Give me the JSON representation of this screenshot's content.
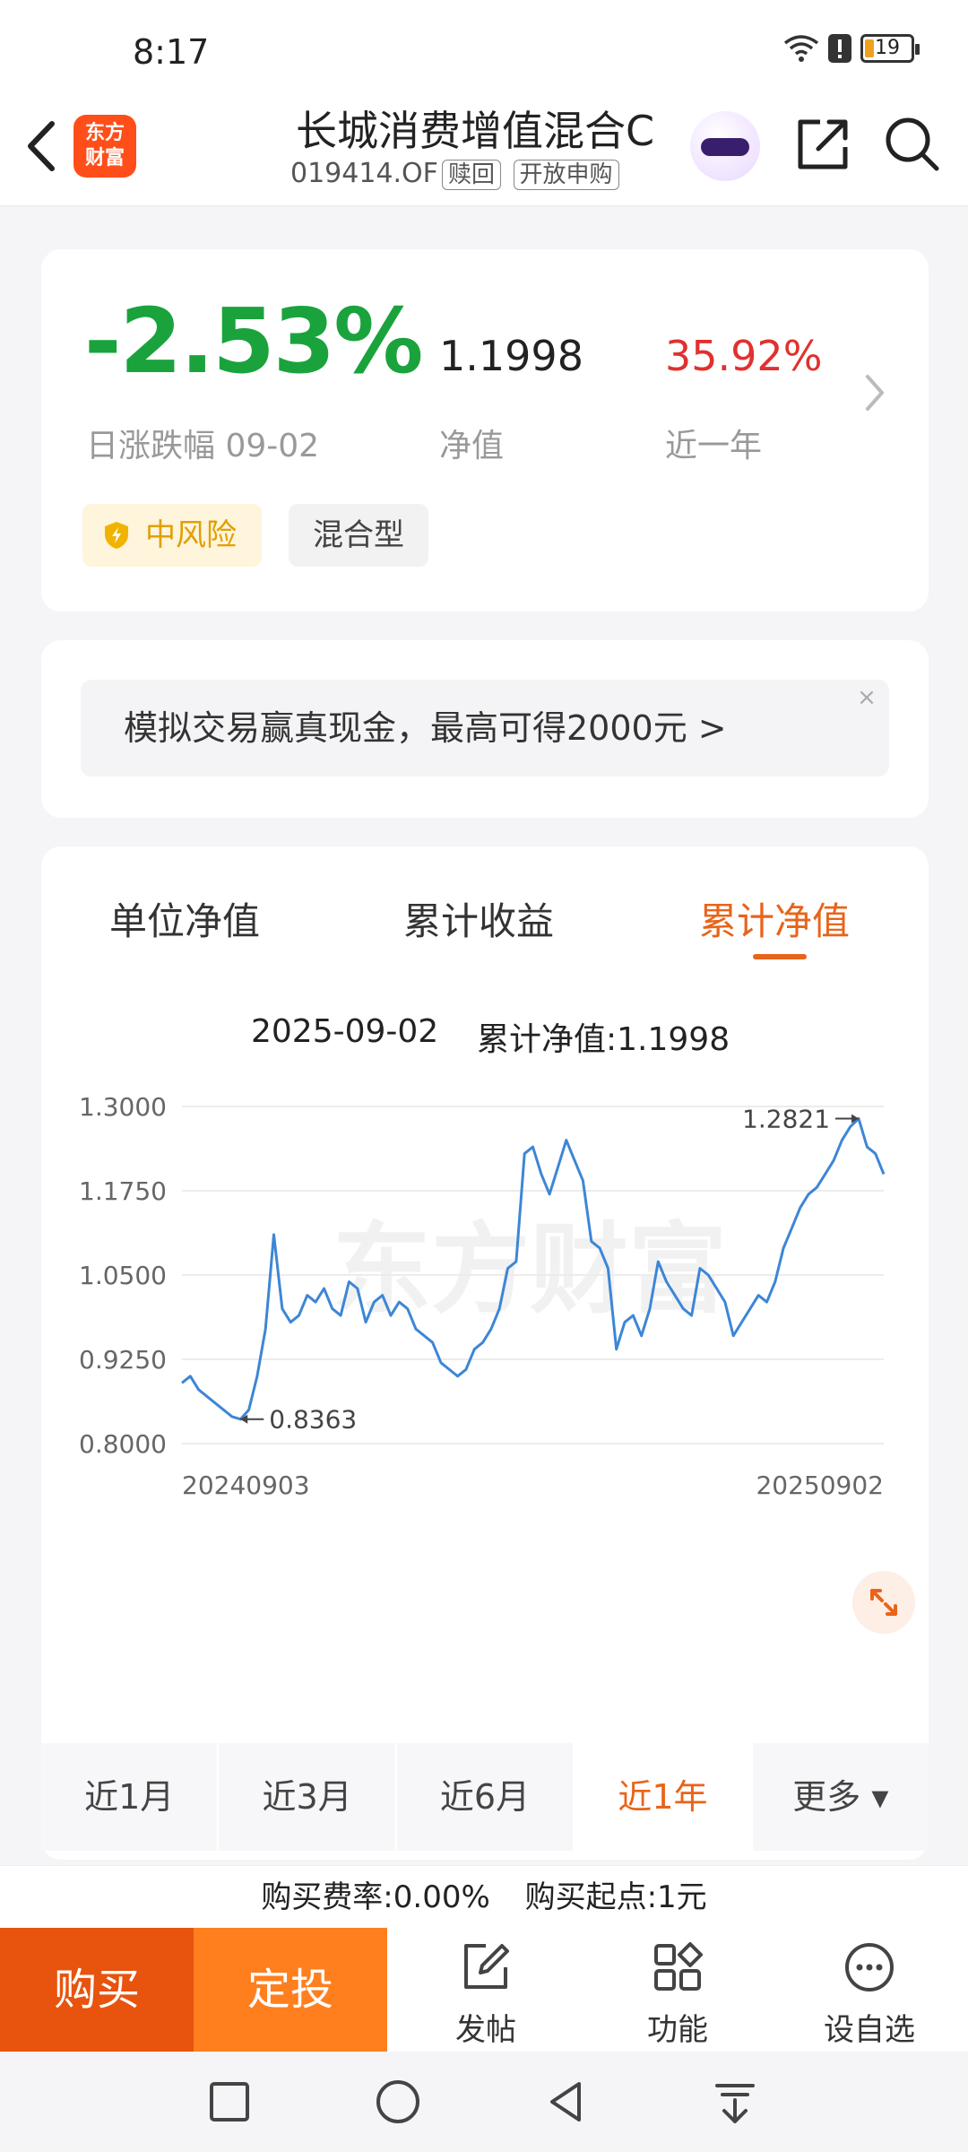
{
  "status": {
    "time": "8:17",
    "battery": "19"
  },
  "header": {
    "logo_line1": "东方",
    "logo_line2": "财富",
    "title": "长城消费增值混合C",
    "code": "019414.OF",
    "tag1": "赎回",
    "tag2": "开放申购"
  },
  "summary": {
    "daily_change": "-2.53%",
    "daily_change_label": "日涨跌幅 09-02",
    "nav": "1.1998",
    "nav_label": "净值",
    "year_return": "35.92%",
    "year_return_label": "近一年",
    "risk": "中风险",
    "type": "混合型",
    "colors": {
      "down": "#1aa33c",
      "up": "#e0312f",
      "accent": "#e8641a"
    }
  },
  "promo": {
    "text": "模拟交易赢真现金，最高可得2000元 >",
    "close": "×"
  },
  "chart_tabs": [
    "单位净值",
    "累计收益",
    "累计净值"
  ],
  "tooltip": {
    "date": "2025-09-02",
    "value": "累计净值:1.1998"
  },
  "chart_data": {
    "type": "line",
    "title": "",
    "ylim": [
      0.8,
      1.3
    ],
    "yticks": [
      "1.3000",
      "1.1750",
      "1.0500",
      "0.9250",
      "0.8000"
    ],
    "x_start_label": "20240903",
    "x_end_label": "20250902",
    "min_label": "0.8363",
    "max_label": "1.2821",
    "watermark": "东方财富",
    "grid": true,
    "legend": "none",
    "color": "#3d86d6",
    "series": [
      {
        "values": [
          0.89,
          0.9,
          0.88,
          0.87,
          0.86,
          0.85,
          0.84,
          0.8363,
          0.85,
          0.9,
          0.97,
          1.11,
          1.0,
          0.98,
          0.99,
          1.02,
          1.01,
          1.03,
          1.0,
          0.99,
          1.04,
          1.03,
          0.98,
          1.01,
          1.02,
          0.99,
          1.01,
          1.0,
          0.97,
          0.96,
          0.95,
          0.92,
          0.91,
          0.9,
          0.91,
          0.94,
          0.95,
          0.97,
          1.0,
          1.06,
          1.07,
          1.23,
          1.24,
          1.2,
          1.17,
          1.21,
          1.25,
          1.22,
          1.19,
          1.1,
          1.09,
          1.06,
          0.94,
          0.98,
          0.99,
          0.96,
          1.0,
          1.07,
          1.04,
          1.02,
          1.0,
          0.99,
          1.06,
          1.05,
          1.03,
          1.01,
          0.96,
          0.98,
          1.0,
          1.02,
          1.01,
          1.04,
          1.09,
          1.12,
          1.15,
          1.17,
          1.18,
          1.2,
          1.22,
          1.25,
          1.27,
          1.2821,
          1.24,
          1.23,
          1.1998
        ]
      }
    ]
  },
  "periods": [
    "近1月",
    "近3月",
    "近6月",
    "近1年",
    "更多 ▾"
  ],
  "fees": {
    "rate": "购买费率:0.00%",
    "min": "购买起点:1元"
  },
  "actions": {
    "buy": "购买",
    "plan": "定投",
    "post": "发帖",
    "features": "功能",
    "watch": "设自选"
  }
}
